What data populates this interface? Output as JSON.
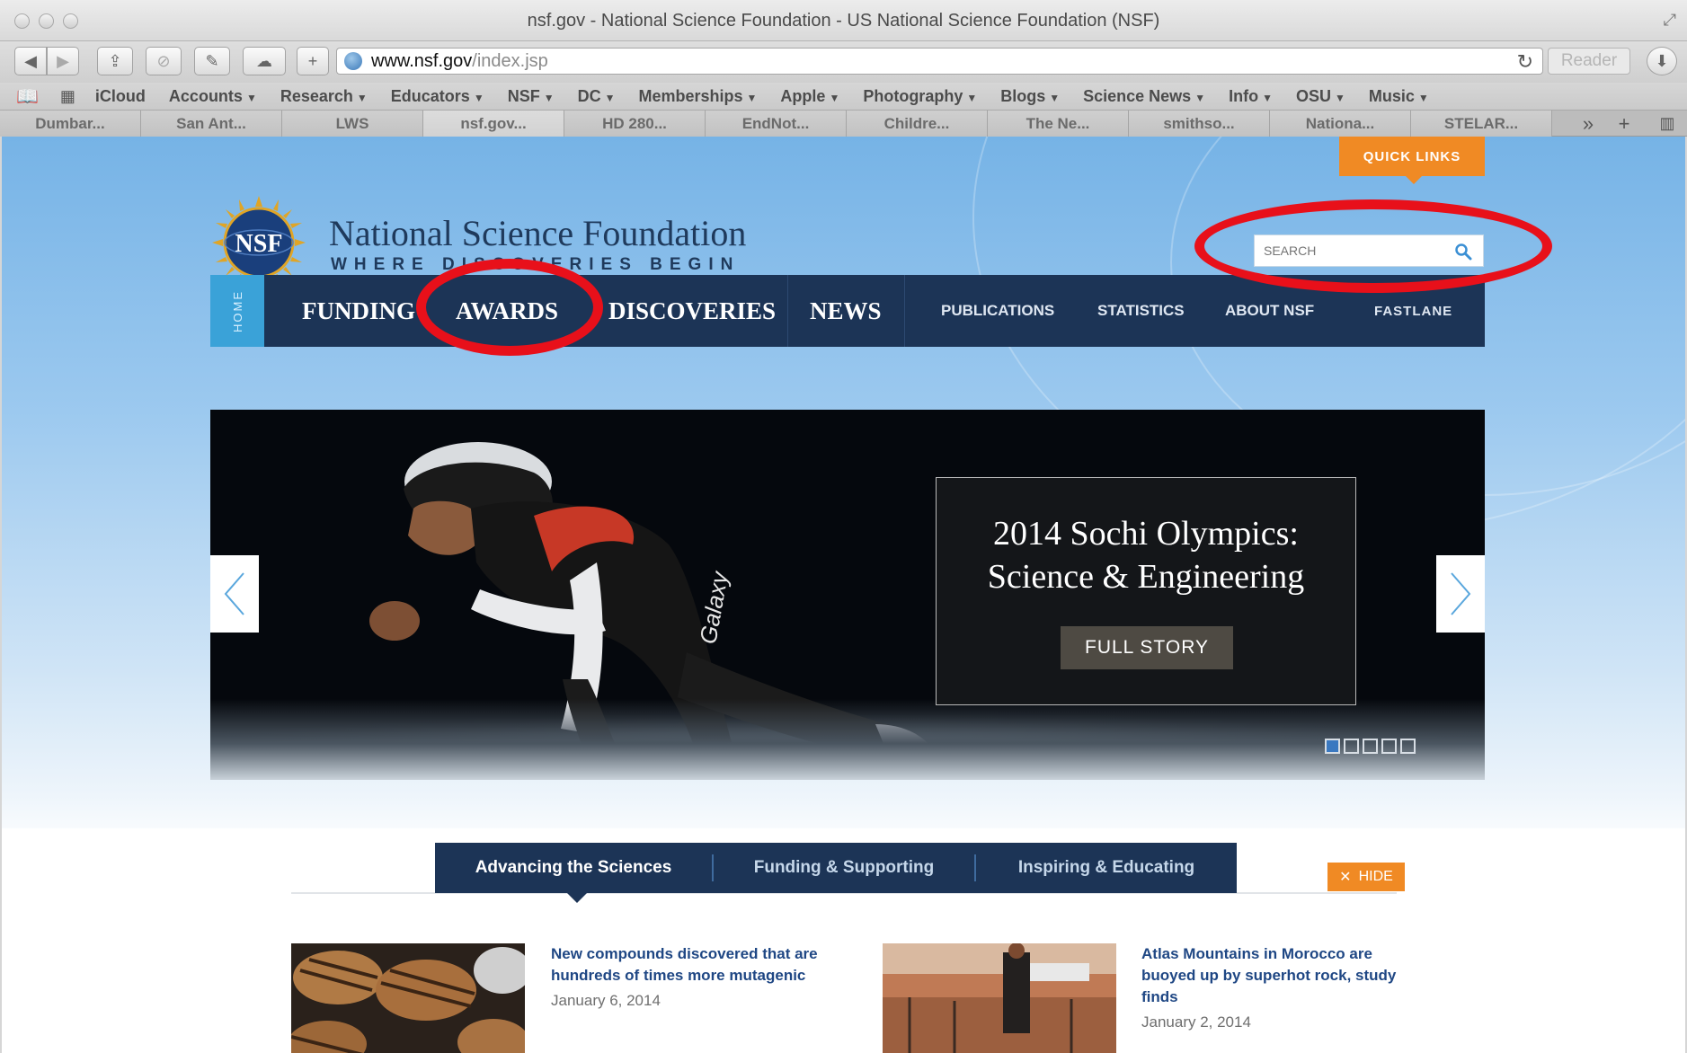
{
  "window": {
    "title": "nsf.gov - National Science Foundation - US National Science Foundation (NSF)"
  },
  "toolbar": {
    "url_host": "www.nsf.gov",
    "url_path": "/index.jsp",
    "reader_label": "Reader",
    "icons": [
      "back-icon",
      "forward-icon",
      "share-icon",
      "stop-icon",
      "notes-icon",
      "icloud-icon",
      "add-icon",
      "reload-icon",
      "download-icon"
    ]
  },
  "bookmarks": {
    "items": [
      {
        "label": "iCloud",
        "menu": false
      },
      {
        "label": "Accounts",
        "menu": true
      },
      {
        "label": "Research",
        "menu": true
      },
      {
        "label": "Educators",
        "menu": true
      },
      {
        "label": "NSF",
        "menu": true
      },
      {
        "label": "DC",
        "menu": true
      },
      {
        "label": "Memberships",
        "menu": true
      },
      {
        "label": "Apple",
        "menu": true
      },
      {
        "label": "Photography",
        "menu": true
      },
      {
        "label": "Blogs",
        "menu": true
      },
      {
        "label": "Science News",
        "menu": true
      },
      {
        "label": "Info",
        "menu": true
      },
      {
        "label": "OSU",
        "menu": true
      },
      {
        "label": "Music",
        "menu": true
      }
    ]
  },
  "tabs": [
    "Dumbar...",
    "San Ant...",
    "LWS",
    "nsf.gov...",
    "HD 280...",
    "EndNot...",
    "Childre...",
    "The Ne...",
    "smithso...",
    "Nationa...",
    "STELAR..."
  ],
  "page": {
    "quick_links": "QUICK LINKS",
    "seal_text": "NSF",
    "brand_name": "National Science Foundation",
    "brand_tagline": "WHERE DISCOVERIES BEGIN",
    "search_placeholder": "SEARCH",
    "nav": {
      "home": "HOME",
      "funding": "FUNDING",
      "awards": "AWARDS",
      "discoveries": "DISCOVERIES",
      "news": "NEWS",
      "publications": "PUBLICATIONS",
      "statistics": "STATISTICS",
      "about": "ABOUT NSF",
      "fastlane": "FASTLANE"
    },
    "hero": {
      "title_line1": "2014 Sochi Olympics:",
      "title_line2": "Science & Engineering",
      "button": "FULL STORY",
      "suit_text": "Galaxy",
      "slides": 5,
      "active_slide": 1
    },
    "section_tabs": {
      "advancing": "Advancing the Sciences",
      "funding": "Funding & Supporting",
      "inspiring": "Inspiring & Educating",
      "hide": "HIDE"
    },
    "stories": [
      {
        "line1": "New compounds discovered that are",
        "line2": "hundreds of times more mutagenic",
        "line3": "",
        "date": "January 6, 2014"
      },
      {
        "line1": "Atlas Mountains in Morocco are",
        "line2": "buoyed up by superhot rock, study",
        "line3": "finds",
        "date": "January 2, 2014"
      }
    ]
  },
  "colors": {
    "nav_bg": "#1c3456",
    "home_tab": "#3aa2d8",
    "accent_orange": "#f08a24",
    "annotation_red": "#e8101a",
    "link_blue": "#1f4784"
  }
}
